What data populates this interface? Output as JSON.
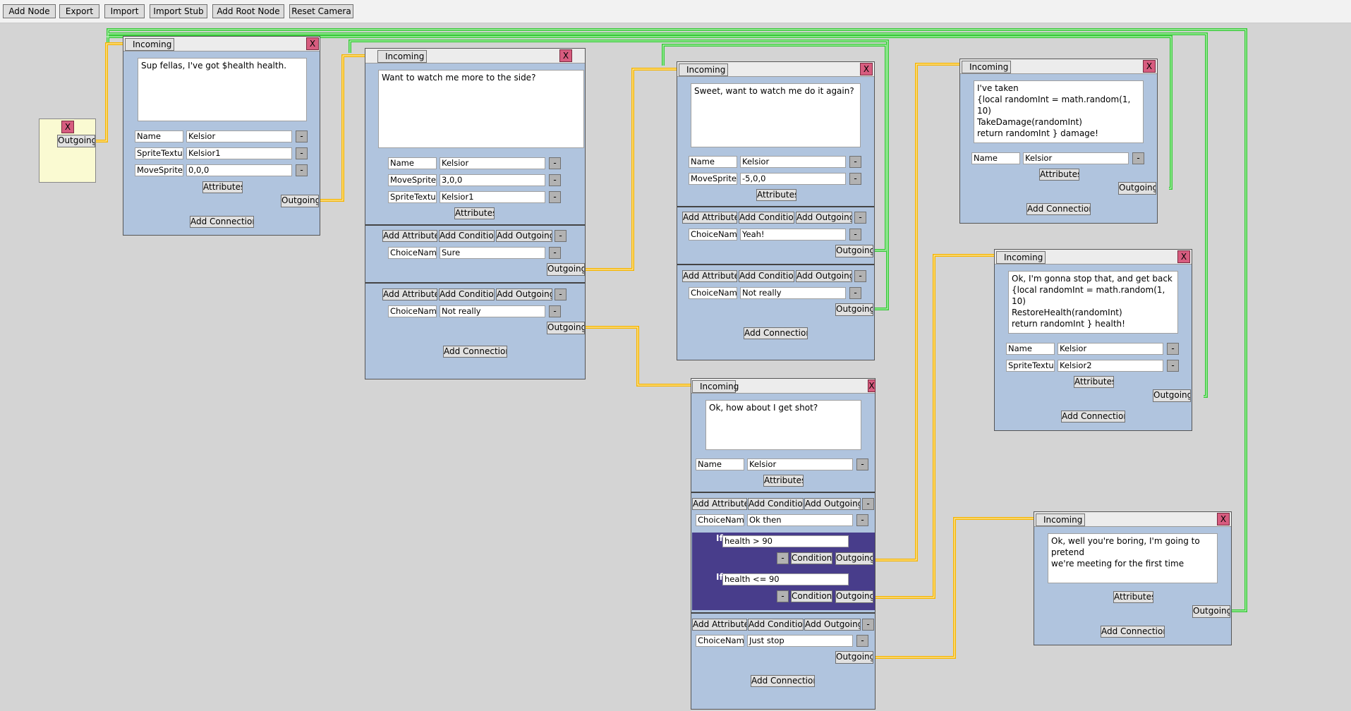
{
  "toolbar": {
    "add_node": "Add Node",
    "export": "Export",
    "import": "Import",
    "import_stub": "Import Stub",
    "add_root_node": "Add Root Node",
    "reset_camera": "Reset Camera"
  },
  "common": {
    "incoming": "Incoming",
    "outgoing": "Outgoing",
    "close": "X",
    "minus": "-",
    "attributes": "Attributes",
    "add_connection": "Add Connection",
    "add_attribute": "Add Attribute",
    "add_condition": "Add Condition",
    "add_outgoing": "Add Outgoing",
    "conditions": "Conditions",
    "if": "If"
  },
  "colors": {
    "canvas": "#d4d4d4",
    "node_body": "#b0c4de",
    "root_node": "#fafad2",
    "close_button": "#d75c7f",
    "condition_block": "#483d8b",
    "wire_choice": "#f5b400",
    "wire_return": "#37c837"
  },
  "nodes": {
    "n1": {
      "text": "Sup fellas, I've got $health health.",
      "fields": [
        {
          "name": "Name",
          "value": "Kelsior"
        },
        {
          "name": "SpriteTexture",
          "value": "Kelsior1"
        },
        {
          "name": "MoveSprite",
          "value": "0,0,0"
        }
      ]
    },
    "n2": {
      "text": "Want to watch me more to the side?",
      "fields": [
        {
          "name": "Name",
          "value": "Kelsior"
        },
        {
          "name": "MoveSprite",
          "value": "3,0,0"
        },
        {
          "name": "SpriteTexture",
          "value": "Kelsior1"
        }
      ],
      "choices": [
        {
          "name": "ChoiceName",
          "value": "Sure"
        },
        {
          "name": "ChoiceName",
          "value": "Not really"
        }
      ]
    },
    "n3": {
      "text": "Sweet, want to watch me do it again?",
      "fields": [
        {
          "name": "Name",
          "value": "Kelsior"
        },
        {
          "name": "MoveSpriteB",
          "value": "-5,0,0"
        }
      ],
      "choices": [
        {
          "name": "ChoiceName",
          "value": "Yeah!"
        },
        {
          "name": "ChoiceName",
          "value": "Not really"
        }
      ]
    },
    "n4": {
      "text": "I've taken\n{local randomInt = math.random(1, 10)\nTakeDamage(randomInt)\nreturn randomInt } damage!",
      "fields": [
        {
          "name": "Name",
          "value": "Kelsior"
        }
      ]
    },
    "n5": {
      "text": "Ok, I'm gonna stop that, and get back\n{local randomInt = math.random(1, 10)\nRestoreHealth(randomInt)\nreturn randomInt } health!",
      "fields": [
        {
          "name": "Name",
          "value": "Kelsior"
        },
        {
          "name": "SpriteTexture",
          "value": "Kelsior2"
        }
      ]
    },
    "n6": {
      "text": "Ok, how about I get shot?",
      "fields": [
        {
          "name": "Name",
          "value": "Kelsior"
        }
      ],
      "choices": [
        {
          "name": "ChoiceName",
          "value": "Ok then",
          "conditions": [
            "health > 90",
            "health <= 90"
          ]
        },
        {
          "name": "ChoiceName",
          "value": "Just stop"
        }
      ]
    },
    "n7": {
      "text": "Ok, well you're boring, I'm going to pretend\nwe're meeting for the first time"
    }
  }
}
